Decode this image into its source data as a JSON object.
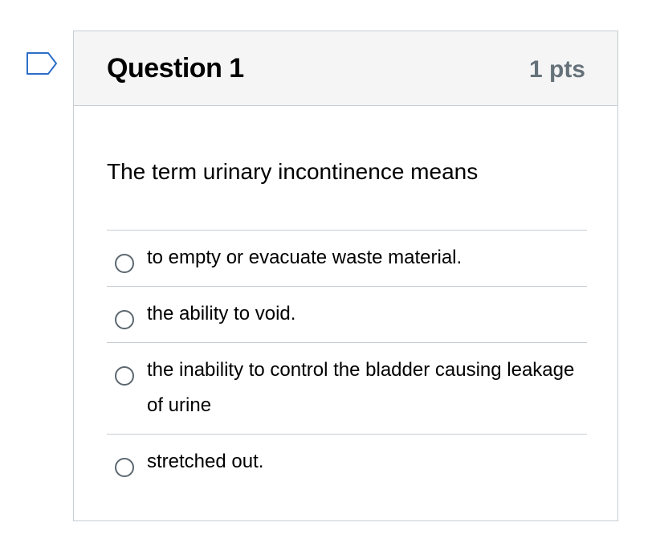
{
  "question": {
    "title": "Question 1",
    "points": "1 pts",
    "text": "The term urinary incontinence means",
    "flag_icon": "bookmark-flag-icon",
    "answers": [
      {
        "label": "to empty or evacuate waste material."
      },
      {
        "label": "the ability to void."
      },
      {
        "label": "the inability to control the bladder causing leakage of urine"
      },
      {
        "label": "stretched out."
      }
    ]
  },
  "colors": {
    "header_bg": "#f5f5f5",
    "border": "#c7cdd1",
    "points_text": "#66727a",
    "flag_stroke": "#2d6ec8"
  }
}
